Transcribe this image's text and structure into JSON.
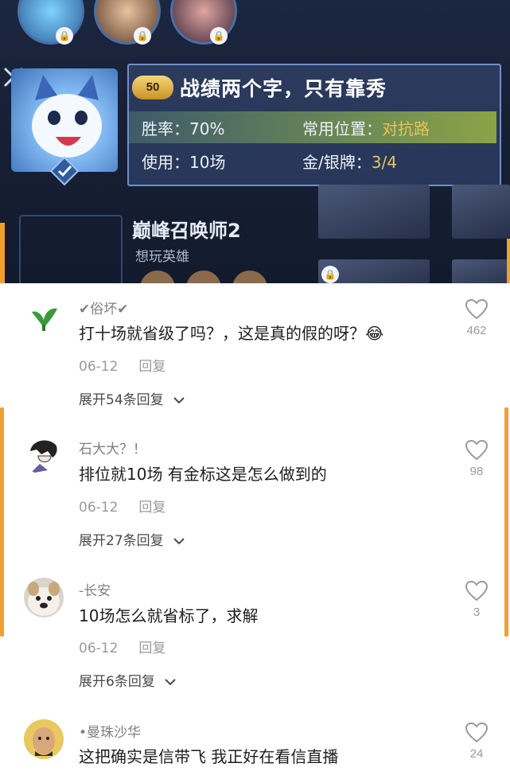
{
  "banner": {
    "level": "50",
    "title": "战绩两个字，只有靠秀",
    "win_rate_label": "胜率：",
    "win_rate_value": "70%",
    "position_label": "常用位置：",
    "position_value": "对抗路",
    "used_label": "使用：",
    "used_value": "10场",
    "medal_label": "金/银牌：",
    "medal_value": "3/4",
    "summoner_title": "巅峰召唤师2",
    "summoner_sub": "想玩英雄"
  },
  "comments": [
    {
      "username": "✔俗坏✔",
      "text": "打十场就省级了吗？，这是真的假的呀？😂",
      "date": "06-12",
      "reply": "回复",
      "expand": "展开54条回复",
      "likes": "462"
    },
    {
      "username": "石大大？！",
      "text": "排位就10场 有金标这是怎么做到的",
      "date": "06-12",
      "reply": "回复",
      "expand": "展开27条回复",
      "likes": "98"
    },
    {
      "username": "-长安",
      "text": "10场怎么就省标了，求解",
      "date": "06-12",
      "reply": "回复",
      "expand": "展开6条回复",
      "likes": "3"
    },
    {
      "username": "•曼珠沙华",
      "text": "这把确实是信带飞 我正好在看信直播",
      "likes": "24"
    }
  ],
  "colors": {
    "accent": "#f0a030",
    "gold": "#e5c35a"
  }
}
